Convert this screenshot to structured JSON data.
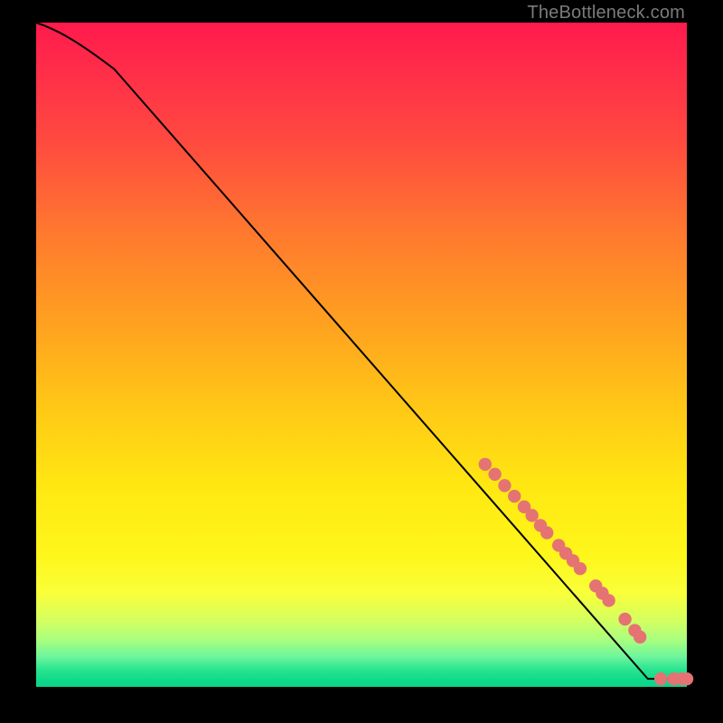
{
  "attribution": "TheBottleneck.com",
  "colors": {
    "curve": "#000000",
    "marker_fill": "#e57373",
    "marker_stroke": "#d66868"
  },
  "chart_data": {
    "type": "line",
    "title": "",
    "xlabel": "",
    "ylabel": "",
    "xlim": [
      0,
      100
    ],
    "ylim": [
      0,
      100
    ],
    "grid": false,
    "legend": false,
    "series": [
      {
        "name": "curve",
        "kind": "line",
        "x": [
          0,
          3,
          6,
          9,
          12,
          100,
          100
        ],
        "y": [
          100,
          99,
          97.5,
          95.5,
          93,
          1.2,
          1.2
        ]
      },
      {
        "name": "markers",
        "kind": "scatter",
        "points": [
          {
            "x": 69.0,
            "y": 33.5
          },
          {
            "x": 70.5,
            "y": 32.0
          },
          {
            "x": 72.0,
            "y": 30.3
          },
          {
            "x": 73.5,
            "y": 28.7
          },
          {
            "x": 75.0,
            "y": 27.1
          },
          {
            "x": 76.2,
            "y": 25.8
          },
          {
            "x": 77.5,
            "y": 24.3
          },
          {
            "x": 78.5,
            "y": 23.2
          },
          {
            "x": 80.3,
            "y": 21.3
          },
          {
            "x": 81.4,
            "y": 20.1
          },
          {
            "x": 82.5,
            "y": 19.0
          },
          {
            "x": 83.6,
            "y": 17.8
          },
          {
            "x": 86.0,
            "y": 15.2
          },
          {
            "x": 87.0,
            "y": 14.1
          },
          {
            "x": 88.0,
            "y": 13.0
          },
          {
            "x": 90.5,
            "y": 10.2
          },
          {
            "x": 92.0,
            "y": 8.5
          },
          {
            "x": 92.8,
            "y": 7.5
          },
          {
            "x": 96.0,
            "y": 1.2
          },
          {
            "x": 98.0,
            "y": 1.2
          },
          {
            "x": 99.2,
            "y": 1.2
          },
          {
            "x": 100.0,
            "y": 1.2
          }
        ]
      }
    ]
  }
}
